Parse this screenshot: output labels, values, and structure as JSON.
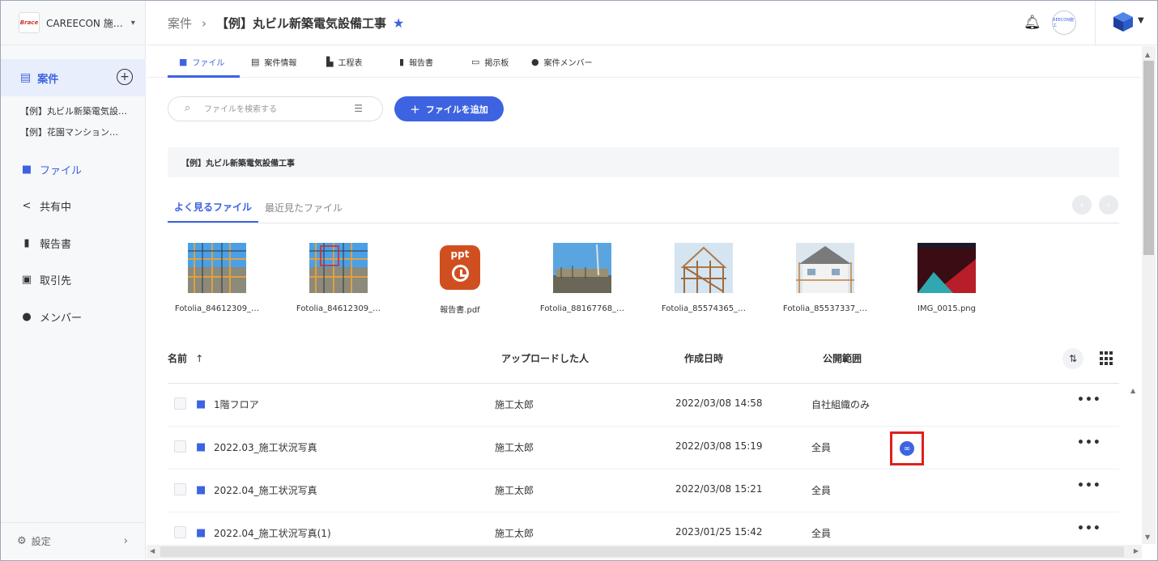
{
  "org": {
    "logo_text": "Brace",
    "name": "CAREECON 施…",
    "caret": "⌄"
  },
  "sidebar": {
    "projects_label": "案件",
    "add_symbol": "+",
    "projects": [
      "【例】丸ビル新築電気設…",
      "【例】花園マンション…"
    ],
    "items": [
      {
        "label": "ファイル",
        "icon": "folder-icon"
      },
      {
        "label": "共有中",
        "icon": "share-icon"
      },
      {
        "label": "報告書",
        "icon": "book-icon"
      },
      {
        "label": "取引先",
        "icon": "contact-icon"
      },
      {
        "label": "メンバー",
        "icon": "person-icon"
      }
    ],
    "settings_label": "設定"
  },
  "header": {
    "breadcrumb_root": "案件",
    "breadcrumb_sep": "›",
    "title": "【例】丸ビル新築電気設備工事",
    "star": "★",
    "avatar_text": "REECON施工"
  },
  "tabs": [
    {
      "label": "ファイル",
      "icon": "folder-icon"
    },
    {
      "label": "案件情報",
      "icon": "clipboard-icon"
    },
    {
      "label": "工程表",
      "icon": "gantt-icon"
    },
    {
      "label": "報告書",
      "icon": "book-icon"
    },
    {
      "label": "掲示板",
      "icon": "board-icon"
    },
    {
      "label": "案件メンバー",
      "icon": "members-icon"
    }
  ],
  "search": {
    "placeholder": "ファイルを検索する",
    "value": ""
  },
  "add_button": {
    "label": "ファイルを追加",
    "plus": "+"
  },
  "path_bar": "【例】丸ビル新築電気設備工事",
  "quick_tabs": {
    "frequent": "よく見るファイル",
    "recent": "最近見たファイル"
  },
  "thumbnails": [
    {
      "name": "Fotolia_84612309_…",
      "kind": "photo-scaffold"
    },
    {
      "name": "Fotolia_84612309_…",
      "kind": "photo-scaffold-marked"
    },
    {
      "name": "報告書.pdf",
      "kind": "ppt",
      "badge": "ppt"
    },
    {
      "name": "Fotolia_88167768_…",
      "kind": "photo-site"
    },
    {
      "name": "Fotolia_85574365_…",
      "kind": "photo-frame"
    },
    {
      "name": "Fotolia_85537337_…",
      "kind": "photo-house"
    },
    {
      "name": "IMG_0015.png",
      "kind": "photo-screen"
    }
  ],
  "table": {
    "columns": {
      "name": "名前",
      "sort_arrow": "↑",
      "uploader": "アップロードした人",
      "created": "作成日時",
      "scope": "公開範囲"
    },
    "rows": [
      {
        "name": "1階フロア",
        "uploader": "施工太郎",
        "created": "2022/03/08 14:58",
        "scope": "自社組織のみ",
        "link": false
      },
      {
        "name": "2022.03_施工状況写真",
        "uploader": "施工太郎",
        "created": "2022/03/08 15:19",
        "scope": "全員",
        "link": true
      },
      {
        "name": "2022.04_施工状況写真",
        "uploader": "施工太郎",
        "created": "2022/03/08 15:21",
        "scope": "全員",
        "link": false
      },
      {
        "name": "2022.04_施工状況写真(1)",
        "uploader": "施工太郎",
        "created": "2023/01/25 15:42",
        "scope": "全員",
        "link": false
      }
    ],
    "more_symbol": "•••"
  },
  "colors": {
    "accent": "#3d63e0",
    "highlight": "#e0201c",
    "ppt": "#d04f20"
  }
}
